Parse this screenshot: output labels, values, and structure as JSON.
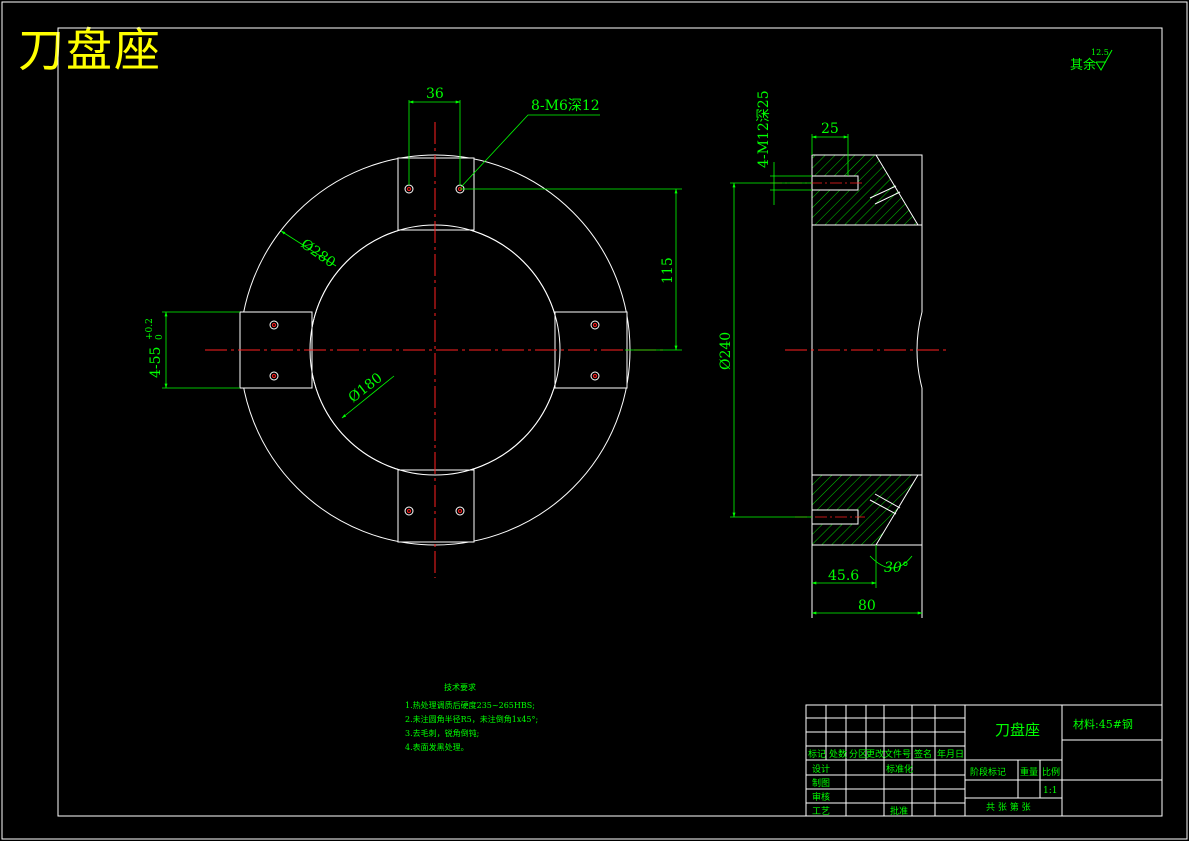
{
  "title": "刀盘座",
  "colors": {
    "frame": "#ffffff",
    "dimension": "#00ff00",
    "centerline": "#ff2020",
    "title": "#ffff00",
    "part": "#ffffff"
  },
  "roughness": {
    "label": "其余",
    "value": "12.5"
  },
  "front_view": {
    "dims": {
      "d280": "Ø280",
      "d180": "Ø180",
      "width36": "36",
      "h115": "115",
      "holes": "8-M6深12",
      "slot": "4-55",
      "slot_tol_upper": "+0.2",
      "slot_tol_lower": "0"
    }
  },
  "side_view": {
    "dims": {
      "d240": "Ø240",
      "w25": "25",
      "tap": "4-M12深25",
      "w45": "45.6",
      "w80": "80",
      "angle": "30°"
    }
  },
  "notes": {
    "heading": "技术要求",
    "items": [
      "1.热处理调质后硬度235~265HBS;",
      "2.未注圆角半径R5，未注倒角1x45°;",
      "3.去毛刺，锐角倒钝;",
      "4.表面发黑处理。"
    ]
  },
  "title_block": {
    "part_name": "刀盘座",
    "material": "材料:45#钢",
    "row_header": [
      "标记",
      "处数",
      "分区",
      "更改文件号",
      "签名",
      "年月日"
    ],
    "design": "设计",
    "standardize": "标准化",
    "draw": "制图",
    "review": "审核",
    "process": "工艺",
    "approve": "批准",
    "stage_header": [
      "阶段标记",
      "重量",
      "比例"
    ],
    "scale": "1:1",
    "sheets": "共 张 第 张"
  }
}
